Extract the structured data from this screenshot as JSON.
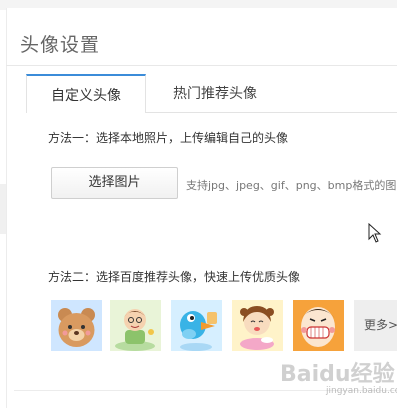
{
  "page": {
    "title": "头像设置"
  },
  "tabs": [
    {
      "label": "自定义头像",
      "active": true
    },
    {
      "label": "热门推荐头像",
      "active": false
    }
  ],
  "custom": {
    "method_one": "方法一：选择本地照片，上传编辑自己的头像",
    "choose_button": "选择图片",
    "support_text": "支持jpg、jpeg、gif、png、bmp格式的图"
  },
  "recommend": {
    "method_two": "方法二：选择百度推荐头像，快速上传优质头像",
    "avatars": [
      {
        "icon": "bear-avatar-icon",
        "bg": "#cfe6ff"
      },
      {
        "icon": "boy-avatar-icon",
        "bg": "#e9f4d8"
      },
      {
        "icon": "bird-avatar-icon",
        "bg": "#d6efff"
      },
      {
        "icon": "girl-avatar-icon",
        "bg": "#fff3c9"
      },
      {
        "icon": "grin-avatar-icon",
        "bg": "#f6a23b"
      }
    ],
    "more_label": "更多>"
  },
  "watermark": {
    "logo": "Baidu经验",
    "sub": "jingyan.baidu.com"
  },
  "colors": {
    "accent": "#3b8cd9"
  }
}
